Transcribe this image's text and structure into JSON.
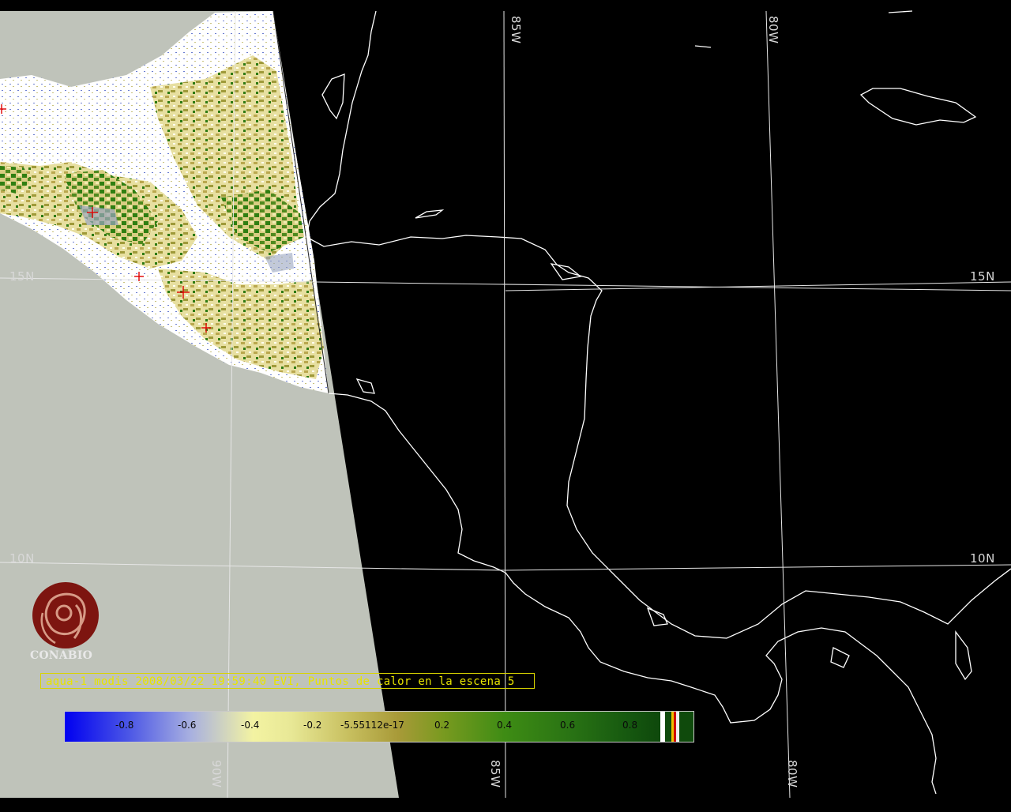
{
  "map": {
    "latitude_labels": [
      "15N",
      "15N",
      "10N",
      "10N"
    ],
    "longitude_labels_top": [
      "85W",
      "80W"
    ],
    "longitude_labels_bottom": [
      "90W",
      "85W",
      "80W"
    ],
    "hotspot_count": 5,
    "colors": {
      "background": "#000000",
      "no_data": "#bfc3ba",
      "grid": "#e6e6e6",
      "coast": "#ffffff",
      "hotspot": "#e00000",
      "caption": "#e8e400"
    }
  },
  "caption": "aqua-1 modis 2008/03/22 19:59:40 EVI, Puntos de calor en la escena 5",
  "colorbar": {
    "ticks": [
      "-0.8",
      "-0.6",
      "-0.4",
      "-0.2",
      "-5.55112e-17",
      "0.2",
      "0.4",
      "0.6",
      "0.8"
    ]
  },
  "logo": {
    "text": "CONABIO"
  }
}
